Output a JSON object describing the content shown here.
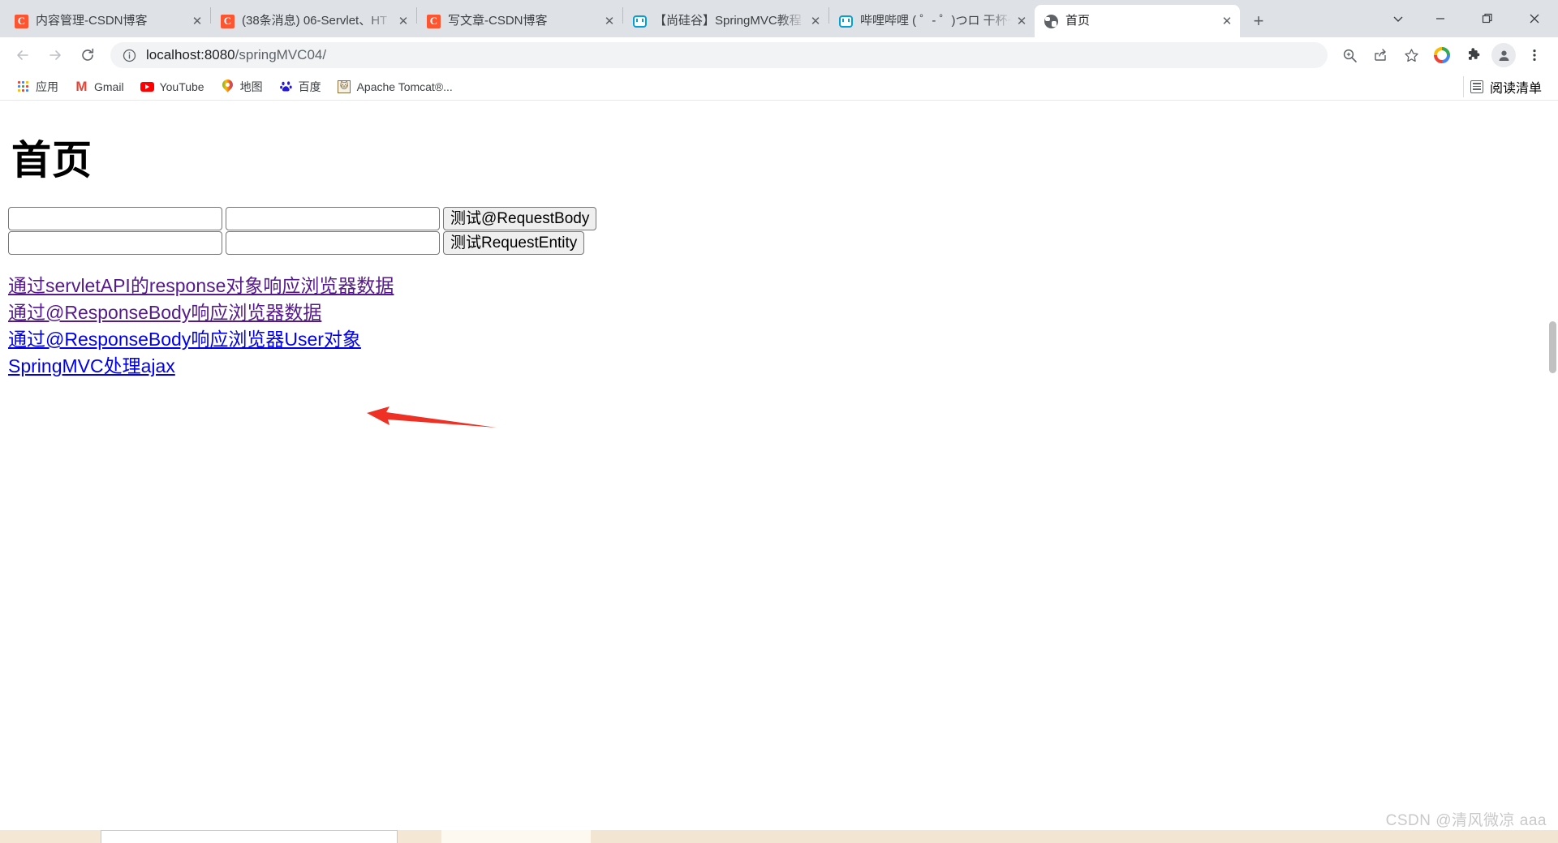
{
  "browser": {
    "tabs": [
      {
        "title": "内容管理-CSDN博客",
        "favicon": "csdn-icon",
        "active": false
      },
      {
        "title": "(38条消息) 06-Servlet、HT",
        "favicon": "csdn-icon",
        "active": false
      },
      {
        "title": "写文章-CSDN博客",
        "favicon": "csdn-icon",
        "active": false
      },
      {
        "title": "【尚硅谷】SpringMVC教程",
        "favicon": "bilibili-icon",
        "active": false
      },
      {
        "title": "哔哩哔哩 ( ゜- ゜)つロ 干杯~",
        "favicon": "bilibili-icon",
        "active": false
      },
      {
        "title": "首页",
        "favicon": "globe-icon",
        "active": true
      }
    ],
    "tab_close_label": "✕",
    "new_tab_label": "+",
    "window_controls": {
      "tab_search": "⌄",
      "minimize": "—",
      "maximize": "❐",
      "close": "✕"
    },
    "toolbar": {
      "back": "←",
      "forward": "→",
      "reload": "⟳",
      "site_info": "ⓘ",
      "url_host": "localhost:8080",
      "url_path": "/springMVC04/",
      "url_full": "localhost:8080/springMVC04/",
      "zoom_icon": "zoom-search-icon",
      "share_icon": "share-icon",
      "bookmark_icon": "star-icon",
      "chrome_labs_icon": "google-color-icon",
      "extensions_icon": "puzzle-icon",
      "profile_icon": "avatar-icon",
      "menu_icon": "three-dot-menu-icon"
    },
    "bookmarks": [
      {
        "label": "应用",
        "icon": "apps-grid-icon"
      },
      {
        "label": "Gmail",
        "icon": "gmail-icon"
      },
      {
        "label": "YouTube",
        "icon": "youtube-icon"
      },
      {
        "label": "地图",
        "icon": "maps-pin-icon"
      },
      {
        "label": "百度",
        "icon": "baidu-icon"
      },
      {
        "label": "Apache Tomcat®...",
        "icon": "tomcat-icon"
      }
    ],
    "reading_list": {
      "label": "阅读清单",
      "icon": "reading-list-icon"
    }
  },
  "page": {
    "heading": "首页",
    "forms": [
      {
        "input_one_value": "",
        "input_two_value": "",
        "submit_label": "测试@RequestBody"
      },
      {
        "input_one_value": "",
        "input_two_value": "",
        "submit_label": "测试RequestEntity"
      }
    ],
    "links": [
      {
        "label": "通过servletAPI的response对象响应浏览器数据",
        "state": "visited"
      },
      {
        "label": "通过@ResponseBody响应浏览器数据",
        "state": "visited"
      },
      {
        "label": "通过@ResponseBody响应浏览器User对象",
        "state": "unvisited"
      },
      {
        "label": "SpringMVC处理ajax",
        "state": "unvisited"
      }
    ],
    "annotation": {
      "type": "red-arrow",
      "color": "#ee3124",
      "points_at": "通过@ResponseBody响应浏览器数据"
    },
    "watermark": "CSDN @清风微凉 aaa"
  }
}
